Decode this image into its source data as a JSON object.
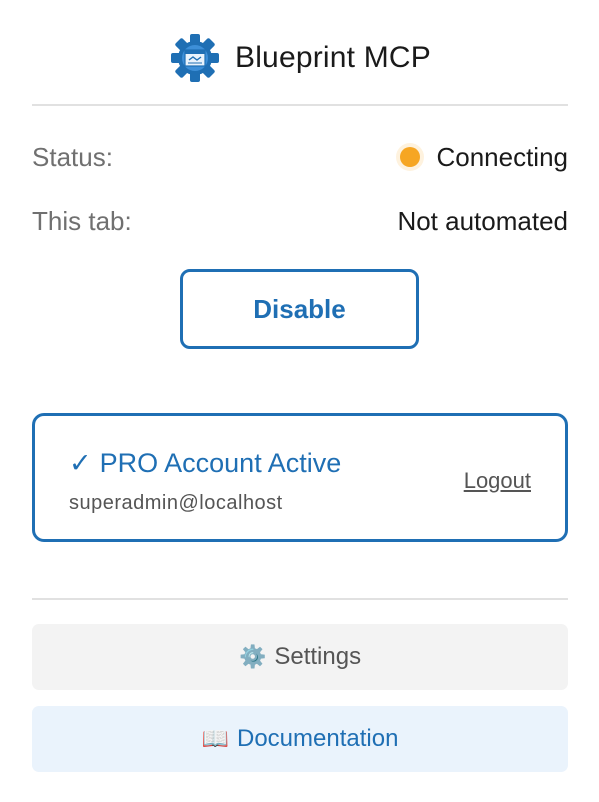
{
  "header": {
    "title": "Blueprint MCP",
    "logo_icon": "blueprint-gear-logo"
  },
  "status": {
    "label": "Status:",
    "value": "Connecting",
    "dot_color": "#f6a623"
  },
  "tab": {
    "label": "This tab:",
    "value": "Not automated"
  },
  "disable_button": {
    "label": "Disable"
  },
  "account": {
    "check_glyph": "✓",
    "status_text": "PRO Account Active",
    "email": "superadmin@localhost",
    "logout_label": "Logout"
  },
  "settings_button": {
    "icon": "⚙️",
    "label": "Settings"
  },
  "docs_button": {
    "icon": "📖",
    "label": "Documentation"
  },
  "colors": {
    "accent": "#1f6fb4",
    "status_connecting": "#f6a623",
    "settings_bg": "#f3f3f3",
    "docs_bg": "#eaf3fc"
  }
}
